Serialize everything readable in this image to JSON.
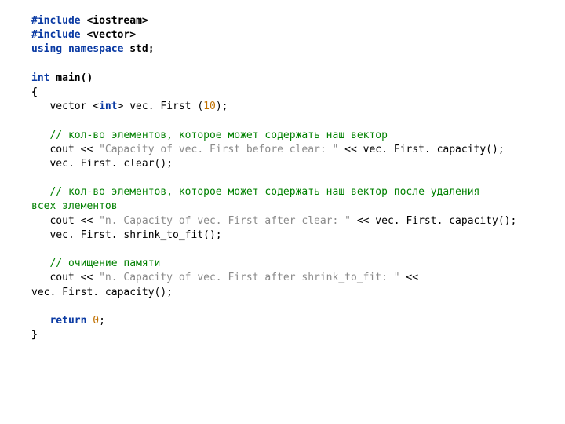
{
  "t": {
    "inc1_kw": "#include",
    "inc1_arg": " <iostream>",
    "inc2_kw": "#include",
    "inc2_arg": " <vector>",
    "using": "using namespace",
    "std": " std;",
    "int": "int",
    "main": " main()",
    "lbrace": "{",
    "decl_pre": "   vector <",
    "decl_int": "int",
    "decl_mid": "> vec. First (",
    "decl_num": "10",
    "decl_end": ");",
    "c1": "   // кол-во элементов, которое может содержать наш вектор",
    "l1a": "   cout << ",
    "l1s": "\"Capacity of vec. First before clear: \"",
    "l1b": " << vec. First. capacity();",
    "l2": "   vec. First. clear();",
    "c2a": "   // кол-во элементов, которое может содержать наш вектор после удаления",
    "c2b": "всех элементов",
    "l3a": "   cout << ",
    "l3s": "\"n. Capacity of vec. First after clear: \"",
    "l3b": " << vec. First. capacity();",
    "l4": "   vec. First. shrink_to_fit();",
    "c3": "   // очищение памяти",
    "l5a": "   cout << ",
    "l5s": "\"n. Capacity of vec. First after shrink_to_fit: \"",
    "l5b": " <<",
    "l5c": "vec. First. capacity();",
    "ret_pre": "   ",
    "ret_kw": "return",
    "ret_sp": " ",
    "ret_num": "0",
    "ret_end": ";",
    "rbrace": "}"
  }
}
